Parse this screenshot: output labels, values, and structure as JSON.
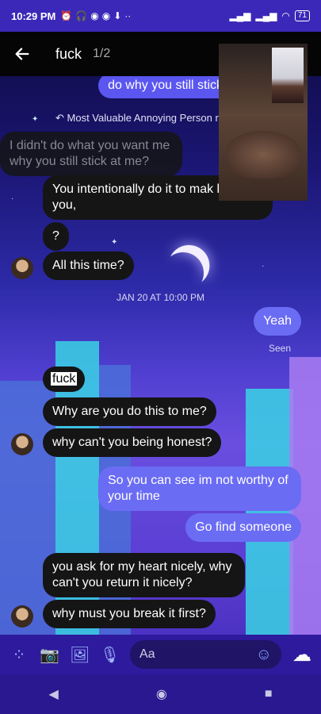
{
  "status": {
    "time": "10:29 PM",
    "battery": "71"
  },
  "header": {
    "title": "fuck",
    "counter": "1/2"
  },
  "reply": {
    "label": "Most Valuable Annoying Person rep"
  },
  "messages": {
    "top_out": "do why you still stick",
    "quoted": "I didn't do what you want me why you still stick at me?",
    "m1": "You intentionally do it to mak leave you,",
    "m2": "?",
    "m3": "All this time?",
    "timestamp": "JAN 20 AT 10:00 PM",
    "m4": "Yeah",
    "seen": "Seen",
    "m5": "fuck",
    "m6": "Why are you do this to me?",
    "m7": "why can't you being honest?",
    "m8": "So you can see im not worthy of your time",
    "m9": "Go find someone",
    "m10": "you ask for my heart nicely, why can't you return it nicely?",
    "m11": "why must you break it first?"
  },
  "composer": {
    "placeholder": "Aa"
  },
  "icons": {
    "back": "arrow-left-icon",
    "grid": "grid-dots-icon",
    "camera": "camera-icon",
    "gallery": "image-icon",
    "mic": "microphone-icon",
    "emoji": "emoji-icon",
    "cloud": "cloud-icon"
  }
}
